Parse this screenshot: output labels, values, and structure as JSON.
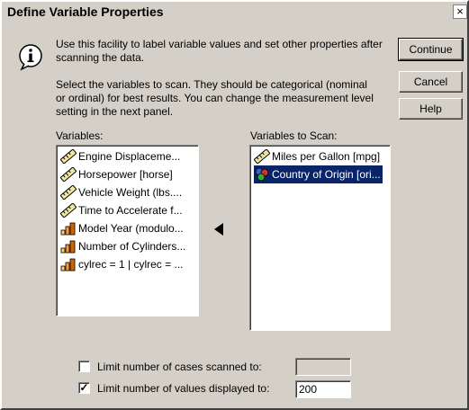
{
  "window": {
    "title": "Define Variable Properties",
    "close_glyph": "×"
  },
  "intro": {
    "icon": "info-icon",
    "line1": "Use this facility to label variable values and set other properties after",
    "line2": "scanning the data.",
    "select_line1": "Select the variables to scan.  They should be categorical (nominal",
    "select_line2": "or ordinal) for best results.  You can change the  measurement level",
    "select_line3": "setting in the next panel."
  },
  "buttons": {
    "continue": "Continue",
    "cancel": "Cancel",
    "help": "Help"
  },
  "variables": {
    "label": "Variables:",
    "items": [
      {
        "icon": "ruler-scale-icon",
        "label": "Engine Displaceme..."
      },
      {
        "icon": "ruler-scale-icon",
        "label": "Horsepower [horse]"
      },
      {
        "icon": "ruler-scale-icon",
        "label": "Vehicle Weight (lbs...."
      },
      {
        "icon": "ruler-scale-icon",
        "label": "Time to Accelerate f..."
      },
      {
        "icon": "ordinal-bars-icon",
        "label": "Model Year (modulo..."
      },
      {
        "icon": "ordinal-bars-icon",
        "label": "Number of Cylinders..."
      },
      {
        "icon": "ordinal-bars-icon",
        "label": "cylrec = 1 | cylrec = ..."
      }
    ]
  },
  "scan": {
    "label": "Variables to Scan:",
    "items": [
      {
        "icon": "ruler-scale-icon",
        "label": "Miles per Gallon [mpg]",
        "selected": false
      },
      {
        "icon": "nominal-balls-icon",
        "label": "Country of Origin [ori...",
        "selected": true
      }
    ]
  },
  "options": {
    "limit_cases_label": "Limit number of cases scanned to:",
    "limit_cases_checked": false,
    "limit_cases_value": "",
    "limit_values_label": "Limit number of values displayed to:",
    "limit_values_checked": true,
    "limit_values_value": "200",
    "check_glyph": "✓"
  },
  "colors": {
    "dialog_bg": "#d4d0c8",
    "selection": "#0a246a"
  }
}
